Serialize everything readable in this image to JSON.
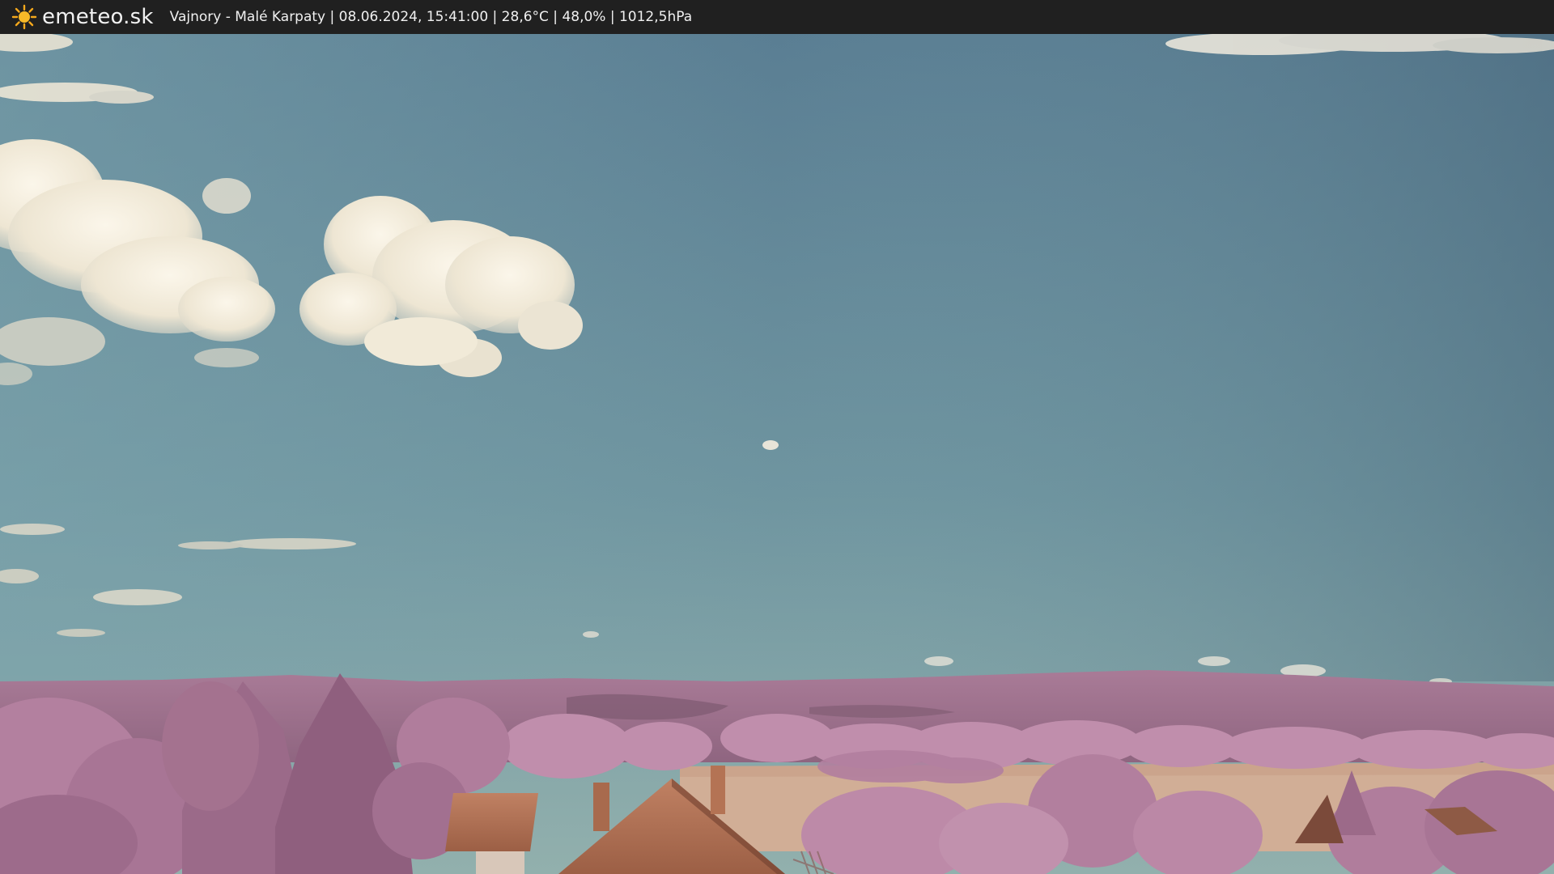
{
  "header": {
    "logo_icon": "sun-icon",
    "brand": "emeteo.sk",
    "caption": "Vajnory - Malé Karpaty | 08.06.2024, 15:41:00 | 28,6°C | 48,0% | 1012,5hPa"
  },
  "colors": {
    "bar_bg": "#202020",
    "sky_top": "#4f6f85",
    "sky_bottom": "#86a9ad",
    "foliage": "#b98aa6",
    "field": "#d3b19a",
    "roof": "#b37353"
  }
}
